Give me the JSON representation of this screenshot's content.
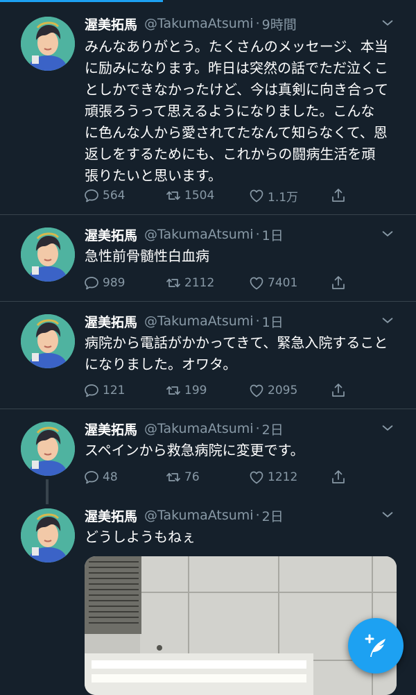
{
  "colors": {
    "background": "#15202b",
    "divider": "#38444d",
    "secondary_text": "#8899a6",
    "accent": "#1da1f2"
  },
  "tweets": [
    {
      "name": "渥美拓馬",
      "handle": "@TakumaAtsumi",
      "time": "9時間",
      "text": "みんなありがとう。たくさんのメッセージ、本当に励みになります。昨日は突然の話でただ泣くことしかできなかったけど、今は真剣に向き合って頑張ろうって思えるようになりました。こんなに色んな人から愛されてたなんて知らなくて、恩返しをするためにも、これからの闘病生活を頑張りたいと思います。",
      "replies": "564",
      "retweets": "1504",
      "likes": "1.1万"
    },
    {
      "name": "渥美拓馬",
      "handle": "@TakumaAtsumi",
      "time": "1日",
      "text": "急性前骨髄性白血病",
      "replies": "989",
      "retweets": "2112",
      "likes": "7401"
    },
    {
      "name": "渥美拓馬",
      "handle": "@TakumaAtsumi",
      "time": "1日",
      "text": "病院から電話がかかってきて、緊急入院することになりました。オワタ。",
      "replies": "121",
      "retweets": "199",
      "likes": "2095"
    },
    {
      "name": "渥美拓馬",
      "handle": "@TakumaAtsumi",
      "time": "2日",
      "text": "スペインから救急病院に変更です。",
      "replies": "48",
      "retweets": "76",
      "likes": "1212"
    },
    {
      "name": "渥美拓馬",
      "handle": "@TakumaAtsumi",
      "time": "2日",
      "text": "どうしようもねぇ"
    }
  ],
  "icons": {
    "reply": "reply-icon",
    "retweet": "retweet-icon",
    "like": "heart-icon",
    "share": "share-icon",
    "caret": "chevron-down-icon",
    "compose": "compose-tweet-icon"
  }
}
